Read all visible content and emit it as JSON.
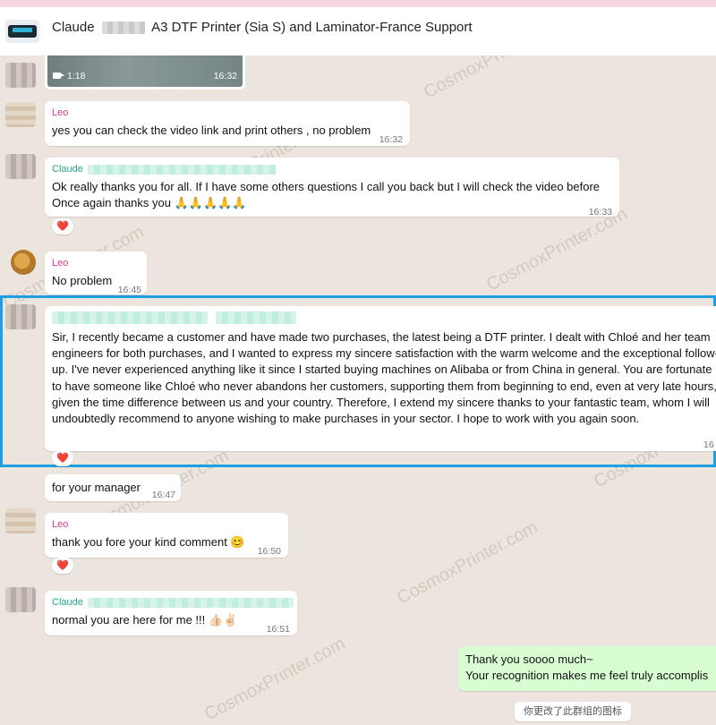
{
  "header": {
    "title_prefix": "Claude",
    "title_suffix": "A3 DTF Printer (Sia S) and Laminator-France Support"
  },
  "video": {
    "duration": "1:18",
    "time": "16:32"
  },
  "messages": [
    {
      "sender": "Leo",
      "text": "yes you can check the video link and print others , no problem",
      "time": "16:32"
    },
    {
      "sender": "Claude",
      "lines": [
        "Ok really thanks you for all. If I have some others questions I call you back but I will check the video before",
        "Once again thanks you 🙏🙏🙏🙏🙏"
      ],
      "time": "16:33",
      "reaction": "❤️"
    },
    {
      "sender": "Leo",
      "text": "No problem",
      "time": "16:45"
    },
    {
      "text": "Sir, I recently became a customer and have made two purchases, the latest being a DTF printer. I dealt with Chloé and her team engineers for both purchases, and I wanted to express my sincere satisfaction with the warm welcome and the exceptional follow-up. I've never experienced anything like it since I started buying machines on Alibaba or from China in general. You are fortunate to have someone like Chloé who never abandons her customers, supporting them from beginning to end, even at very late hours, given the time difference between us and your country. Therefore, I extend my sincere thanks to your fantastic team, whom I will undoubtedly recommend to anyone wishing to make purchases in your sector. I hope to work with you again soon.",
      "time": "16",
      "reaction": "❤️"
    },
    {
      "text": "for  your  manager",
      "time": "16:47"
    },
    {
      "sender": "Leo",
      "text": "thank you fore your kind comment 😊",
      "time": "16:50",
      "reaction": "❤️"
    },
    {
      "sender": "Claude",
      "text": "normal  you are  here  for  me  !!! 👍🏻✌🏻",
      "time": "16:51"
    },
    {
      "outgoing": true,
      "lines": [
        "Thank you soooo much~",
        "Your recognition makes me feel truly accomplis"
      ]
    }
  ],
  "system_message": "你更改了此群组的图标",
  "watermark": "CosmoxPrinter.com"
}
